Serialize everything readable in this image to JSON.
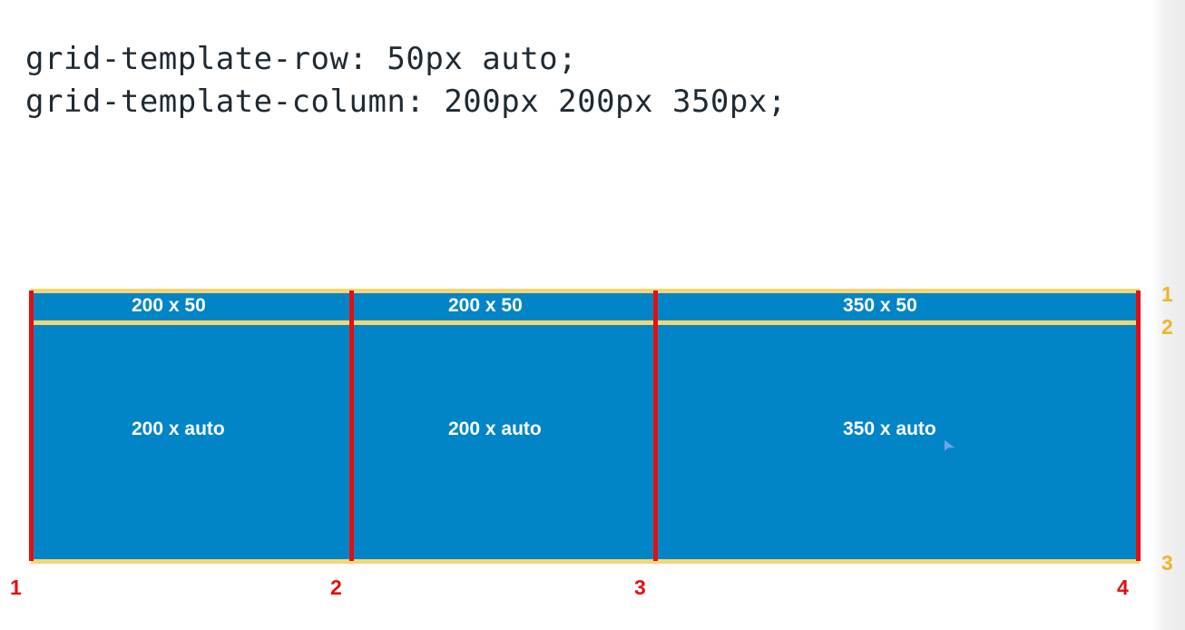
{
  "code": {
    "line1": "grid-template-row: 50px auto;",
    "line2": "grid-template-column: 200px 200px 350px;"
  },
  "cells": [
    {
      "label": "200 x 50"
    },
    {
      "label": "200 x 50"
    },
    {
      "label": "350 x 50"
    },
    {
      "label": "200 x auto"
    },
    {
      "label": "200 x auto"
    },
    {
      "label": "350 x auto"
    }
  ],
  "column_lines": [
    "1",
    "2",
    "3",
    "4"
  ],
  "row_lines": [
    "1",
    "2",
    "3"
  ],
  "colors": {
    "cell_fill": "#0185c7",
    "column_line": "#e30f0f",
    "row_line": "#f6d673",
    "row_number": "#f0b429",
    "code_text": "#1f2a33"
  }
}
